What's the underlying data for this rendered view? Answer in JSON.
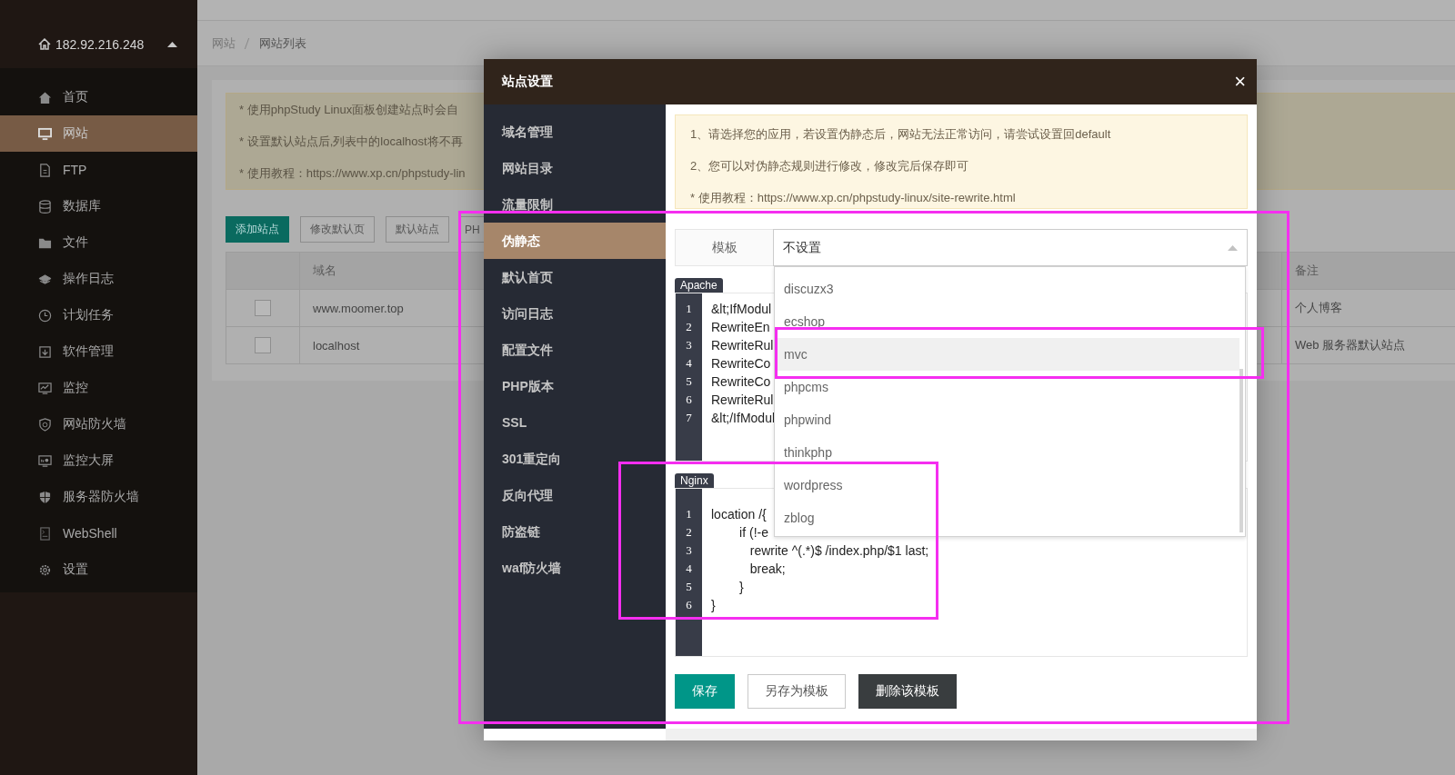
{
  "sidebar": {
    "server": {
      "ip": "182.92.216.248",
      "expanded": true
    },
    "items": [
      {
        "label": "首页",
        "selected": false
      },
      {
        "label": "网站",
        "selected": true
      },
      {
        "label": "FTP",
        "selected": false
      },
      {
        "label": "数据库",
        "selected": false
      },
      {
        "label": "文件",
        "selected": false
      },
      {
        "label": "操作日志",
        "selected": false
      },
      {
        "label": "计划任务",
        "selected": false
      },
      {
        "label": "软件管理",
        "selected": false
      },
      {
        "label": "监控",
        "selected": false
      },
      {
        "label": "网站防火墙",
        "selected": false
      },
      {
        "label": "监控大屏",
        "selected": false
      },
      {
        "label": "服务器防火墙",
        "selected": false
      },
      {
        "label": "WebShell",
        "selected": false
      },
      {
        "label": "设置",
        "selected": false
      }
    ]
  },
  "breadcrumb": [
    "网站",
    "网站列表"
  ],
  "notice": [
    "* 使用phpStudy Linux面板创建站点时会自",
    "* 设置默认站点后,列表中的localhost将不再",
    "* 使用教程：https://www.xp.cn/phpstudy-lin"
  ],
  "toolbar": [
    {
      "label": "添加站点",
      "kind": "primary"
    },
    {
      "label": "修改默认页",
      "kind": "plain"
    },
    {
      "label": "默认站点",
      "kind": "plain"
    },
    {
      "label": "PH",
      "kind": "plain"
    }
  ],
  "table": {
    "columns": [
      "域名",
      "备注"
    ],
    "rows": [
      {
        "checked": false,
        "domain": "www.moomer.top",
        "note": "个人博客"
      },
      {
        "checked": false,
        "domain": "localhost",
        "note": "Web 服务器默认站点"
      }
    ]
  },
  "dialog": {
    "title": "站点设置",
    "close": "×",
    "nav": [
      {
        "label": "域名管理",
        "selected": false
      },
      {
        "label": "网站目录",
        "selected": false
      },
      {
        "label": "流量限制",
        "selected": false
      },
      {
        "label": "伪静态",
        "selected": true
      },
      {
        "label": "默认首页",
        "selected": false
      },
      {
        "label": "访问日志",
        "selected": false
      },
      {
        "label": "配置文件",
        "selected": false
      },
      {
        "label": "PHP版本",
        "selected": false
      },
      {
        "label": "SSL",
        "selected": false
      },
      {
        "label": "301重定向",
        "selected": false
      },
      {
        "label": "反向代理",
        "selected": false
      },
      {
        "label": "防盗链",
        "selected": false
      },
      {
        "label": "waf防火墙",
        "selected": false
      }
    ],
    "tips": [
      "1、请选择您的应用，若设置伪静态后，网站无法正常访问，请尝试设置回default",
      "2、您可以对伪静态规则进行修改，修改完后保存即可",
      "* 使用教程：https://www.xp.cn/phpstudy-linux/site-rewrite.html"
    ],
    "template": {
      "label": "模板",
      "value": "不设置",
      "expanded": true,
      "options": [
        {
          "label": "discuzx3",
          "selected": false
        },
        {
          "label": "ecshop",
          "selected": false
        },
        {
          "label": "mvc",
          "selected": true
        },
        {
          "label": "phpcms",
          "selected": false
        },
        {
          "label": "phpwind",
          "selected": false
        },
        {
          "label": "thinkphp",
          "selected": false
        },
        {
          "label": "wordpress",
          "selected": false
        },
        {
          "label": "zblog",
          "selected": false
        }
      ]
    },
    "editors": [
      {
        "tab": "Apache",
        "lines": [
          {
            "no": "1",
            "text": "&lt;IfModul"
          },
          {
            "no": "2",
            "text": "RewriteEn"
          },
          {
            "no": "3",
            "text": "RewriteRul"
          },
          {
            "no": "4",
            "text": "RewriteCo"
          },
          {
            "no": "5",
            "text": "RewriteCo"
          },
          {
            "no": "6",
            "text": "RewriteRul"
          },
          {
            "no": "7",
            "text": "&lt;/IfModul"
          }
        ]
      },
      {
        "tab": "Nginx",
        "lines": [
          {
            "no": "1",
            "text": "location /{"
          },
          {
            "no": "2",
            "text": "        if (!-e"
          },
          {
            "no": "3",
            "text": "           rewrite ^(.*)$ /index.php/$1 last;"
          },
          {
            "no": "4",
            "text": "           break;"
          },
          {
            "no": "5",
            "text": "        }"
          },
          {
            "no": "6",
            "text": "}"
          }
        ]
      }
    ],
    "buttons": [
      {
        "label": "保存",
        "kind": "primary"
      },
      {
        "label": "另存为模板",
        "kind": "plain"
      },
      {
        "label": "删除该模板",
        "kind": "dark"
      }
    ]
  }
}
